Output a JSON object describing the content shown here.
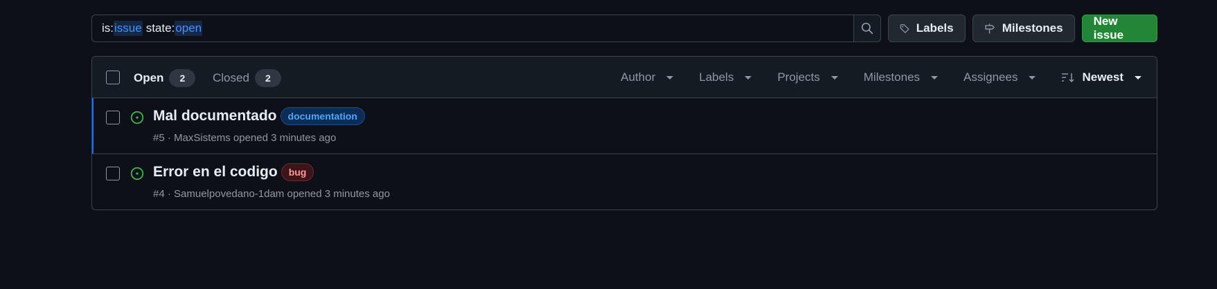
{
  "search": {
    "qualifier1_key": "is:",
    "qualifier1_value": "issue",
    "qualifier2_key": "state:",
    "qualifier2_value": "open"
  },
  "toolbar": {
    "labels_label": "Labels",
    "milestones_label": "Milestones",
    "new_issue_label": "New issue"
  },
  "tabs": {
    "open_label": "Open",
    "open_count": "2",
    "closed_label": "Closed",
    "closed_count": "2"
  },
  "filters": {
    "author": "Author",
    "labels": "Labels",
    "projects": "Projects",
    "milestones": "Milestones",
    "assignees": "Assignees",
    "sort": "Newest"
  },
  "issues": [
    {
      "title": "Mal documentado",
      "label": "documentation",
      "number": "#5",
      "author": "MaxSistems",
      "opened": "opened 3 minutes ago"
    },
    {
      "title": "Error en el codigo",
      "label": "bug",
      "number": "#4",
      "author": "Samuelpovedano-1dam",
      "opened": "opened 3 minutes ago"
    }
  ],
  "colors": {
    "background": "#0d1117",
    "accent_green": "#238636",
    "open_icon": "#3fb950",
    "link_blue": "#4493f8"
  }
}
